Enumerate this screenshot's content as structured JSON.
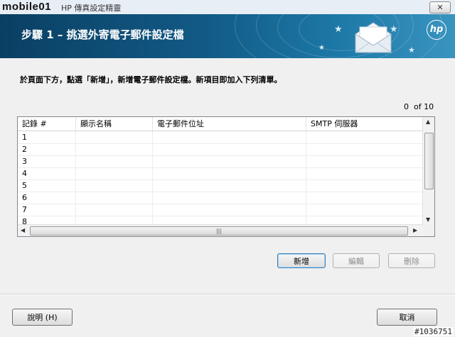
{
  "window": {
    "brand": "mobile01",
    "title": "HP 傳真設定精靈",
    "close_glyph": "✕"
  },
  "banner": {
    "title": "步驟 1 – 挑選外寄電子郵件設定檔",
    "accent_color": "#125a86"
  },
  "instruction": "於頁面下方，點選「新增」，新增電子郵件設定檔。新項目即加入下列清單。",
  "count": {
    "current": "0",
    "label": "of 10"
  },
  "table": {
    "columns": [
      "記錄 #",
      "顯示名稱",
      "電子郵件位址",
      "SMTP 伺服器"
    ],
    "rows": [
      [
        "1",
        "",
        "",
        ""
      ],
      [
        "2",
        "",
        "",
        ""
      ],
      [
        "3",
        "",
        "",
        ""
      ],
      [
        "4",
        "",
        "",
        ""
      ],
      [
        "5",
        "",
        "",
        ""
      ],
      [
        "6",
        "",
        "",
        ""
      ],
      [
        "7",
        "",
        "",
        ""
      ],
      [
        "8",
        "",
        "",
        ""
      ]
    ]
  },
  "actions": {
    "add": "新增",
    "edit": "編輯",
    "delete": "刪除"
  },
  "footer": {
    "help": "說明 (H)",
    "cancel": "取消"
  },
  "watermark": "#1036751",
  "icons": [
    "envelope-icon",
    "hp-logo-icon",
    "close-icon",
    "scroll-up-icon",
    "scroll-down-icon",
    "scroll-left-icon",
    "scroll-right-icon"
  ]
}
